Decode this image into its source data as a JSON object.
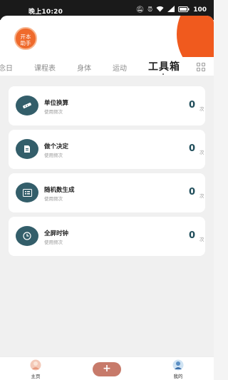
{
  "status_bar": {
    "time": "晚上10:20",
    "battery": "100",
    "icons": [
      "mute-icon",
      "alarm-icon",
      "wifi-icon",
      "signal-icon",
      "battery-icon"
    ]
  },
  "app": {
    "logo_text_line1": "开本",
    "logo_text_line2": "助手",
    "accent_color": "#f05a1e"
  },
  "tabs": [
    {
      "label": "念日"
    },
    {
      "label": "课程表"
    },
    {
      "label": "身体"
    },
    {
      "label": "运动"
    },
    {
      "label": "工具箱",
      "active": true
    }
  ],
  "tools": [
    {
      "title": "单位换算",
      "subtitle": "使用频次",
      "count": "0",
      "unit": "次",
      "icon": "ruler-icon"
    },
    {
      "title": "做个决定",
      "subtitle": "使用频次",
      "count": "0",
      "unit": "次",
      "icon": "document-icon"
    },
    {
      "title": "随机数生成",
      "subtitle": "使用频次",
      "count": "0",
      "unit": "次",
      "icon": "calculator-icon"
    },
    {
      "title": "全屏时钟",
      "subtitle": "使用频次",
      "count": "0",
      "unit": "次",
      "icon": "clock-icon"
    }
  ],
  "bottom_nav": {
    "home_label": "主页",
    "add_label": "+",
    "profile_label": "我的"
  }
}
